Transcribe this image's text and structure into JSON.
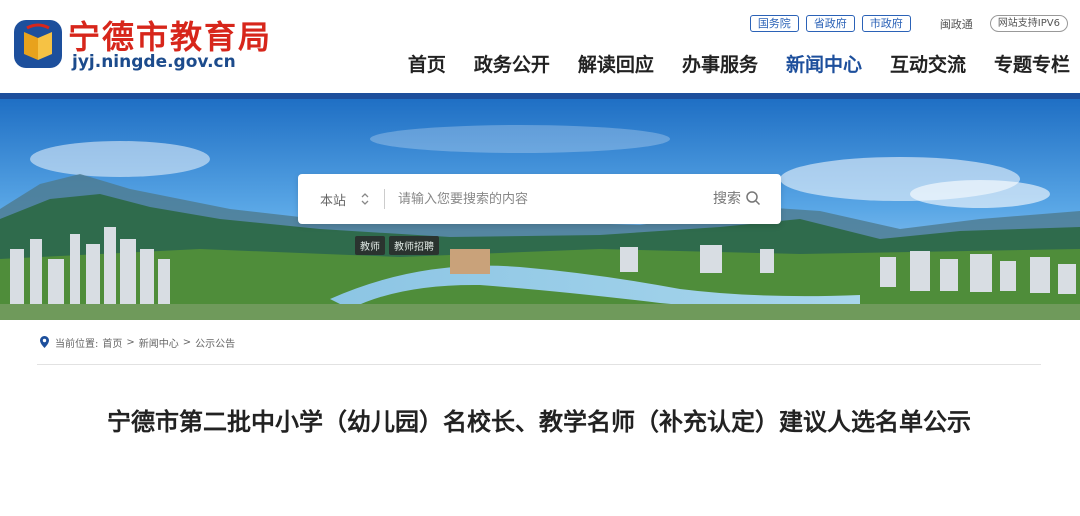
{
  "header": {
    "site_title": "宁德市教育局",
    "site_domain": "jyj.ningde.gov.cn",
    "top_links": [
      "国务院",
      "省政府",
      "市政府"
    ],
    "min_zheng_tong": "闽政通",
    "ipv6_badge": "网站支持IPV6",
    "nav": [
      "首页",
      "政务公开",
      "解读回应",
      "办事服务",
      "新闻中心",
      "互动交流",
      "专题专栏"
    ],
    "active_nav": "新闻中心"
  },
  "search": {
    "scope": "本站",
    "placeholder": "请输入您要搜索的内容",
    "button_label": "搜索"
  },
  "hot_tags": [
    "教师",
    "教师招聘"
  ],
  "breadcrumb": {
    "prefix": "当前位置:",
    "items": [
      "首页",
      "新闻中心",
      "公示公告"
    ],
    "separator": ">"
  },
  "article": {
    "title": "宁德市第二批中小学（幼儿园）名校长、教学名师（补充认定）建议人选名单公示"
  },
  "colors": {
    "brand_red": "#d7261b",
    "brand_blue": "#1d4f9c"
  }
}
